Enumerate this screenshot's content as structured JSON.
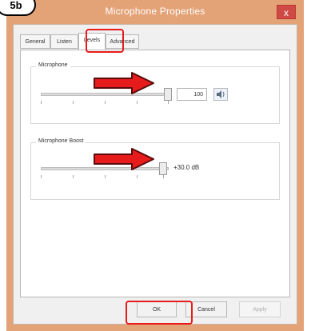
{
  "badge": "5b",
  "window": {
    "title": "Microphone Properties",
    "close_label": "x"
  },
  "tabs": [
    {
      "label": "General"
    },
    {
      "label": "Listen"
    },
    {
      "label": "Levels"
    },
    {
      "label": "Advanced"
    }
  ],
  "active_tab": "Levels",
  "microphone": {
    "label": "Microphone",
    "value": "100",
    "level": 1.0
  },
  "boost": {
    "label": "Microphone Boost",
    "value": "+30.0 dB",
    "level": 1.0
  },
  "buttons": {
    "ok": "OK",
    "cancel": "Cancel",
    "apply": "Apply"
  },
  "colors": {
    "title_bar": "#e4a277",
    "close_button": "#cf4a45",
    "annotation": "#e61c1c"
  }
}
